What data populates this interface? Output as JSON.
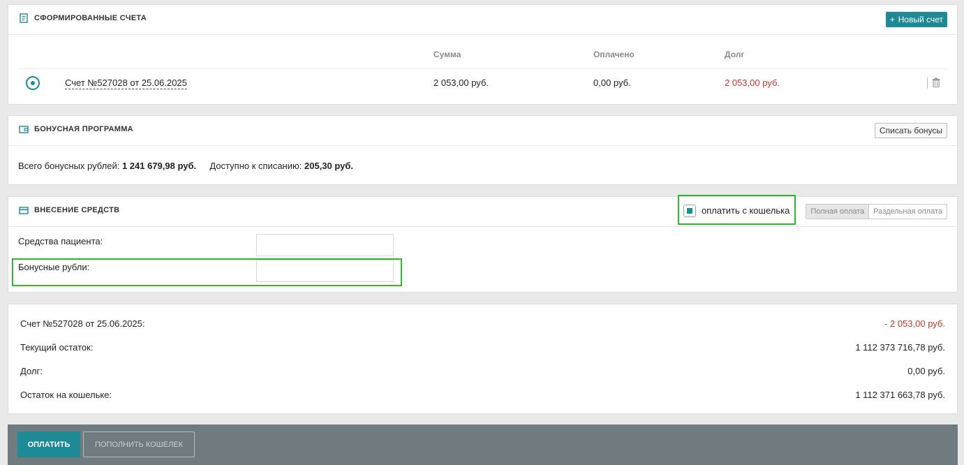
{
  "invoices": {
    "title": "СФОРМИРОВАННЫЕ СЧЕТА",
    "new_button": "Новый счет",
    "columns": {
      "sum": "Сумма",
      "paid": "Оплачено",
      "debt": "Долг"
    },
    "row": {
      "name": "Счет №527028 от 25.06.2025",
      "sum": "2 053,00 руб.",
      "paid": "0,00 руб.",
      "debt": "2 053,00 руб."
    }
  },
  "bonus": {
    "title": "БОНУСНАЯ ПРОГРАММА",
    "writeoff_button": "Списать бонусы",
    "total_label": "Всего бонусных рублей:",
    "total_value": "1 241 679,98 руб.",
    "available_label": "Доступно к списанию:",
    "available_value": "205,30 руб."
  },
  "deposit": {
    "title": "ВНЕСЕНИЕ СРЕДСТВ",
    "wallet_checkbox_label": "оплатить с кошелька",
    "wallet_checked": true,
    "payment_modes": [
      "Полная оплата",
      "Раздельная оплата"
    ],
    "active_mode": "Полная оплата",
    "patient_funds_label": "Средства пациента:",
    "patient_funds_value": "",
    "bonus_rubles_label": "Бонусные рубли:",
    "bonus_rubles_value": ""
  },
  "summary": {
    "rows": [
      {
        "label": "Счет №527028 от 25.06.2025:",
        "value": "- 2 053,00 руб."
      },
      {
        "label": "Текущий остаток:",
        "value": "1 112 373 716,78 руб."
      },
      {
        "label": "Долг:",
        "value": "0,00 руб."
      },
      {
        "label": "Остаток на кошельке:",
        "value": "1 112 371 663,78 руб."
      }
    ]
  },
  "actions": {
    "pay": "ОПЛАТИТЬ",
    "topup": "ПОПОЛНИТЬ КОШЕЛЕК"
  },
  "colors": {
    "accent": "#1e8a95",
    "debt": "#c0392b",
    "highlight": "#2fb52f"
  },
  "icons": [
    "invoice-icon",
    "plus-icon",
    "wallet-icon",
    "card-icon",
    "trash-icon"
  ]
}
